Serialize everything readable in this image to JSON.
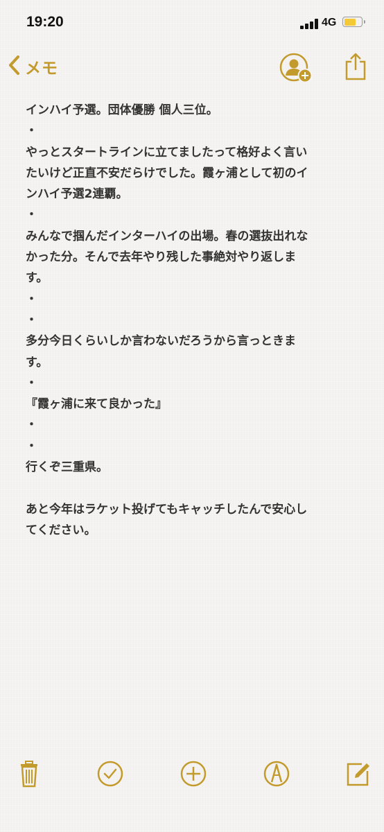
{
  "status_bar": {
    "time": "19:20",
    "network": "4G",
    "battery_level": 0.72,
    "signal_bars": 4
  },
  "nav": {
    "back_label": "メモ"
  },
  "colors": {
    "accent": "#c39a2c",
    "background": "#f5f4f2",
    "text": "#333333"
  },
  "note": {
    "lines": [
      "インハイ予選。団体優勝 個人三位。",
      "・",
      "やっとスタートラインに立てましたって格好よく言い",
      "たいけど正直不安だらけでした。霞ヶ浦として初のイ",
      "ンハイ予選2連覇。",
      "・",
      "みんなで掴んだインターハイの出場。春の選抜出れな",
      "かった分。そんで去年やり残した事絶対やり返しま",
      "す。",
      "・",
      "・",
      "多分今日くらいしか言わないだろうから言っときま",
      "す。",
      "・",
      "『霞ヶ浦に来て良かった』",
      "・",
      "・",
      "行くぞ三重県。",
      "",
      "あと今年はラケット投げてもキャッチしたんで安心し",
      "てください。"
    ]
  },
  "toolbar": {
    "icons": [
      "trash-icon",
      "checklist-icon",
      "add-icon",
      "markup-icon",
      "compose-icon"
    ]
  }
}
